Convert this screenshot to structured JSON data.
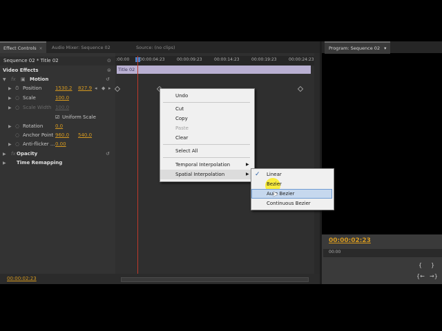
{
  "tabs": {
    "effect_controls": "Effect Controls",
    "audio_mixer": "Audio Mixer: Sequence 02",
    "source": "Source: (no clips)",
    "close": "×"
  },
  "effect_panel": {
    "sequence_title": "Sequence 02 * Title 02",
    "video_effects": "Video Effects",
    "motion": "Motion",
    "position_label": "Position",
    "position_x": "1530.2",
    "position_y": "827.9",
    "scale_label": "Scale",
    "scale_value": "100.0",
    "scale_width_label": "Scale Width",
    "scale_width_value": "100.0",
    "uniform_scale": "Uniform Scale",
    "rotation_label": "Rotation",
    "rotation_value": "0.0",
    "anchor_label": "Anchor Point",
    "anchor_x": "960.0",
    "anchor_y": "540.0",
    "antiflicker_label": "Anti-flicker ...",
    "antiflicker_value": "0.00",
    "opacity": "Opacity",
    "time_remapping": "Time Remapping",
    "fx": "fx"
  },
  "timeline": {
    "ticks": [
      ":00:00",
      "00:00:04:23",
      "00:00:09:23",
      "00:00:14:23",
      "00:00:19:23",
      "00:00:24:23"
    ],
    "clip_label": "Title 02",
    "current_time": "00:00:02:23"
  },
  "context_menu": {
    "undo": "Undo",
    "cut": "Cut",
    "copy": "Copy",
    "paste": "Paste",
    "clear": "Clear",
    "select_all": "Select All",
    "temporal": "Temporal Interpolation",
    "spatial": "Spatial Interpolation",
    "submenu": {
      "linear": "Linear",
      "bezier": "Bezier",
      "auto_bezier": "Auto Bezier",
      "continuous_bezier": "Continuous Bezier",
      "checked": "Linear"
    }
  },
  "program_monitor": {
    "tab": "Program: Sequence 02",
    "dropdown": "▾",
    "timecode": "00:00:02:23",
    "ruler_start": "00:00"
  },
  "colors": {
    "accent_time": "#d79a1f",
    "clip_bar": "#b9b0d2",
    "playhead": "#c0392b",
    "highlight_cursor": "#faeb1e"
  }
}
